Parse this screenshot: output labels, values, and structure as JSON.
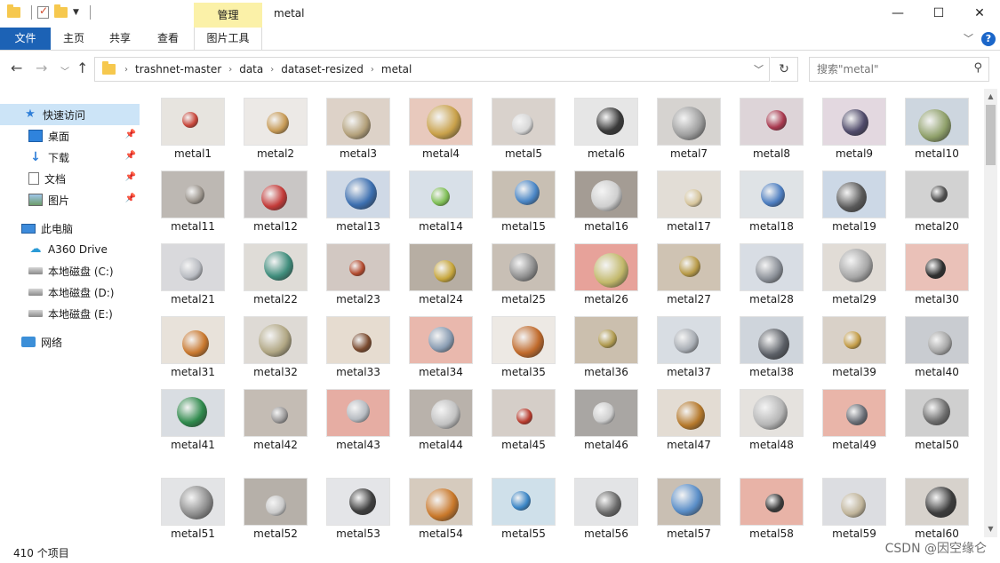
{
  "window": {
    "title": "metal",
    "context_tab": "管理",
    "controls": {
      "minimize": "—",
      "maximize": "☐",
      "close": "✕"
    }
  },
  "ribbon": {
    "tabs": [
      "文件",
      "主页",
      "共享",
      "查看",
      "图片工具"
    ]
  },
  "address": {
    "path": [
      "trashnet-master",
      "data",
      "dataset-resized",
      "metal"
    ],
    "search_placeholder": "搜索\"metal\""
  },
  "sidebar": {
    "items": [
      {
        "label": "快速访问",
        "icon": "star-icon",
        "selected": true,
        "pinned": false
      },
      {
        "label": "桌面",
        "icon": "desktop-icon",
        "selected": false,
        "pinned": true
      },
      {
        "label": "下载",
        "icon": "download-icon",
        "selected": false,
        "pinned": true
      },
      {
        "label": "文档",
        "icon": "document-icon",
        "selected": false,
        "pinned": true
      },
      {
        "label": "图片",
        "icon": "pictures-icon",
        "selected": false,
        "pinned": true
      },
      {
        "label": "此电脑",
        "icon": "computer-icon",
        "selected": false,
        "pinned": false
      },
      {
        "label": "A360 Drive",
        "icon": "cloud-drive-icon",
        "selected": false,
        "pinned": false
      },
      {
        "label": "本地磁盘 (C:)",
        "icon": "drive-icon",
        "selected": false,
        "pinned": false
      },
      {
        "label": "本地磁盘 (D:)",
        "icon": "drive-icon",
        "selected": false,
        "pinned": false
      },
      {
        "label": "本地磁盘 (E:)",
        "icon": "drive-icon",
        "selected": false,
        "pinned": false
      },
      {
        "label": "网络",
        "icon": "network-icon",
        "selected": false,
        "pinned": false
      }
    ]
  },
  "files": [
    {
      "name": "metal1",
      "bg": "#e7e4df",
      "obj": "#c8463a"
    },
    {
      "name": "metal2",
      "bg": "#ece9e6",
      "obj": "#c79a55"
    },
    {
      "name": "metal3",
      "bg": "#ddd2c8",
      "obj": "#b3a07a"
    },
    {
      "name": "metal4",
      "bg": "#e8c9bd",
      "obj": "#c9a14a"
    },
    {
      "name": "metal5",
      "bg": "#d9d2cc",
      "obj": "#d8d8d8"
    },
    {
      "name": "metal6",
      "bg": "#e6e6e6",
      "obj": "#3a3a3a"
    },
    {
      "name": "metal7",
      "bg": "#d6d3d0",
      "obj": "#9e9e9e"
    },
    {
      "name": "metal8",
      "bg": "#ddd4d8",
      "obj": "#a8384e"
    },
    {
      "name": "metal9",
      "bg": "#e3d8e0",
      "obj": "#4f4a6a"
    },
    {
      "name": "metal10",
      "bg": "#cdd6df",
      "obj": "#8fa06a"
    },
    {
      "name": "metal11",
      "bg": "#bdb8b3",
      "obj": "#9b948c"
    },
    {
      "name": "metal12",
      "bg": "#c9c6c5",
      "obj": "#c33a38"
    },
    {
      "name": "metal13",
      "bg": "#cfd9e6",
      "obj": "#3c6fb0"
    },
    {
      "name": "metal14",
      "bg": "#d8e0e8",
      "obj": "#7fbf55"
    },
    {
      "name": "metal15",
      "bg": "#c8bfb3",
      "obj": "#4a86c6"
    },
    {
      "name": "metal16",
      "bg": "#a49c94",
      "obj": "#cfcfcf"
    },
    {
      "name": "metal17",
      "bg": "#e2ddd6",
      "obj": "#d6c59c"
    },
    {
      "name": "metal18",
      "bg": "#dfe3e6",
      "obj": "#4c7dc0"
    },
    {
      "name": "metal19",
      "bg": "#ccd8e6",
      "obj": "#5a5a5a"
    },
    {
      "name": "metal20",
      "bg": "#d2d2d2",
      "obj": "#4f4f4f"
    },
    {
      "name": "metal21",
      "bg": "#d9d9dc",
      "obj": "#b9bcc2"
    },
    {
      "name": "metal22",
      "bg": "#dfdcd7",
      "obj": "#3f8d7c"
    },
    {
      "name": "metal23",
      "bg": "#d2c8c2",
      "obj": "#b24a2e"
    },
    {
      "name": "metal24",
      "bg": "#b7aea3",
      "obj": "#c7a63c"
    },
    {
      "name": "metal25",
      "bg": "#c8bfb5",
      "obj": "#8f8f8f"
    },
    {
      "name": "metal26",
      "bg": "#e7a29a",
      "obj": "#c2b86a"
    },
    {
      "name": "metal27",
      "bg": "#cfc3b3",
      "obj": "#b89b48"
    },
    {
      "name": "metal28",
      "bg": "#d8dde4",
      "obj": "#8b9098"
    },
    {
      "name": "metal29",
      "bg": "#e1dcd6",
      "obj": "#a6a6a6"
    },
    {
      "name": "metal30",
      "bg": "#eac1b8",
      "obj": "#2e2e2e"
    },
    {
      "name": "metal31",
      "bg": "#e8e2da",
      "obj": "#c9782e"
    },
    {
      "name": "metal32",
      "bg": "#dedad5",
      "obj": "#b1a784"
    },
    {
      "name": "metal33",
      "bg": "#e6dcd0",
      "obj": "#7a4a2e"
    },
    {
      "name": "metal34",
      "bg": "#e9b8ad",
      "obj": "#8a9db3"
    },
    {
      "name": "metal35",
      "bg": "#ede9e4",
      "obj": "#c06a2b"
    },
    {
      "name": "metal36",
      "bg": "#cbbfae",
      "obj": "#b09a4f"
    },
    {
      "name": "metal37",
      "bg": "#d8dde3",
      "obj": "#a9aeb5"
    },
    {
      "name": "metal38",
      "bg": "#cfd5dc",
      "obj": "#5b5f66"
    },
    {
      "name": "metal39",
      "bg": "#d9d1c8",
      "obj": "#c49d48"
    },
    {
      "name": "metal40",
      "bg": "#c9ccd1",
      "obj": "#a5a5a5"
    },
    {
      "name": "metal41",
      "bg": "#d9dde2",
      "obj": "#2f8a4c"
    },
    {
      "name": "metal42",
      "bg": "#c4bcb4",
      "obj": "#9a9898"
    },
    {
      "name": "metal43",
      "bg": "#e6ada3",
      "obj": "#b7bcc2"
    },
    {
      "name": "metal44",
      "bg": "#b9b2ab",
      "obj": "#c2c2c2"
    },
    {
      "name": "metal45",
      "bg": "#d5cec8",
      "obj": "#b83a2c"
    },
    {
      "name": "metal46",
      "bg": "#a9a6a3",
      "obj": "#cfcfcf"
    },
    {
      "name": "metal47",
      "bg": "#e3dcd3",
      "obj": "#b5782a"
    },
    {
      "name": "metal48",
      "bg": "#e5e2de",
      "obj": "#b6b6b6"
    },
    {
      "name": "metal49",
      "bg": "#e9b5a9",
      "obj": "#6a6e76"
    },
    {
      "name": "metal50",
      "bg": "#cfcfcf",
      "obj": "#6f6f6f"
    },
    {
      "name": "metal51",
      "bg": "#e3e4e6",
      "obj": "#8c8c8c"
    },
    {
      "name": "metal52",
      "bg": "#b6b0a9",
      "obj": "#cacaca"
    },
    {
      "name": "metal53",
      "bg": "#e4e5e8",
      "obj": "#3f3f3f"
    },
    {
      "name": "metal54",
      "bg": "#d6cbbe",
      "obj": "#c9782a"
    },
    {
      "name": "metal55",
      "bg": "#cfe0ea",
      "obj": "#3b86c6"
    },
    {
      "name": "metal56",
      "bg": "#e3e4e6",
      "obj": "#6a6a6a"
    },
    {
      "name": "metal57",
      "bg": "#c9bfb3",
      "obj": "#5a8ec8"
    },
    {
      "name": "metal58",
      "bg": "#e8b3a7",
      "obj": "#3a3a3a"
    },
    {
      "name": "metal59",
      "bg": "#dcdde1",
      "obj": "#c0b49a"
    },
    {
      "name": "metal60",
      "bg": "#d7d2cc",
      "obj": "#3c3c3c"
    }
  ],
  "status": {
    "item_count": "410 个项目"
  },
  "watermark": "CSDN @因空缘仑"
}
